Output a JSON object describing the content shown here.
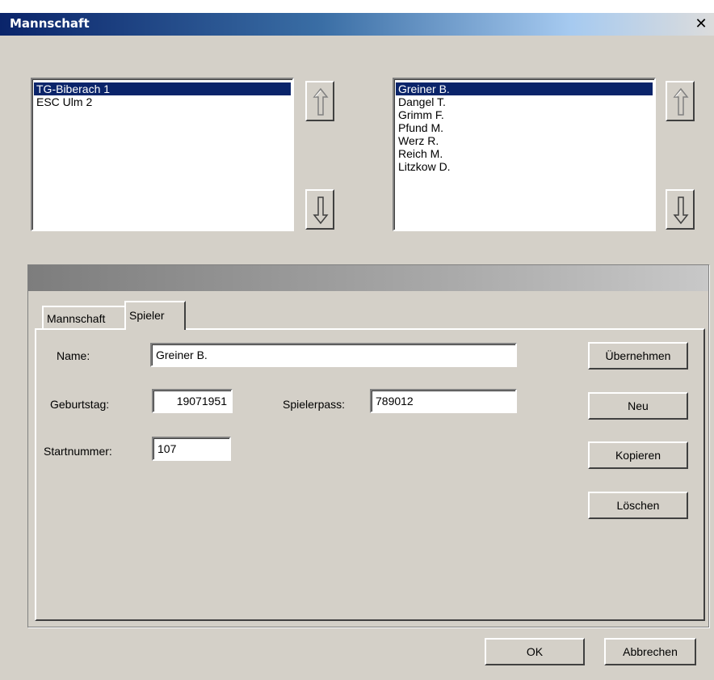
{
  "window": {
    "title": "Mannschaft",
    "close_glyph": "✕"
  },
  "teams": {
    "items": [
      "TG-Biberach 1",
      "ESC Ulm 2"
    ],
    "selected": 0
  },
  "players": {
    "items": [
      "Greiner B.",
      "Dangel T.",
      "Grimm F.",
      "Pfund M.",
      "Werz R.",
      "Reich M.",
      "Litzkow D."
    ],
    "selected": 0
  },
  "icons": {
    "move_up": "arrow-up-icon",
    "move_down": "arrow-down-icon"
  },
  "tabs": [
    {
      "label": "Mannschaft"
    },
    {
      "label": "Spieler"
    }
  ],
  "active_tab": 1,
  "form": {
    "name_label": "Name:",
    "name_value": "Greiner B.",
    "birthday_label": "Geburtstag:",
    "birthday_value": "19071951",
    "pass_label": "Spielerpass:",
    "pass_value": "789012",
    "startnr_label": "Startnummer:",
    "startnr_value": "107"
  },
  "actions": {
    "apply": "Übernehmen",
    "new": "Neu",
    "copy": "Kopieren",
    "delete": "Löschen"
  },
  "dialog_buttons": {
    "ok": "OK",
    "cancel": "Abbrechen"
  }
}
